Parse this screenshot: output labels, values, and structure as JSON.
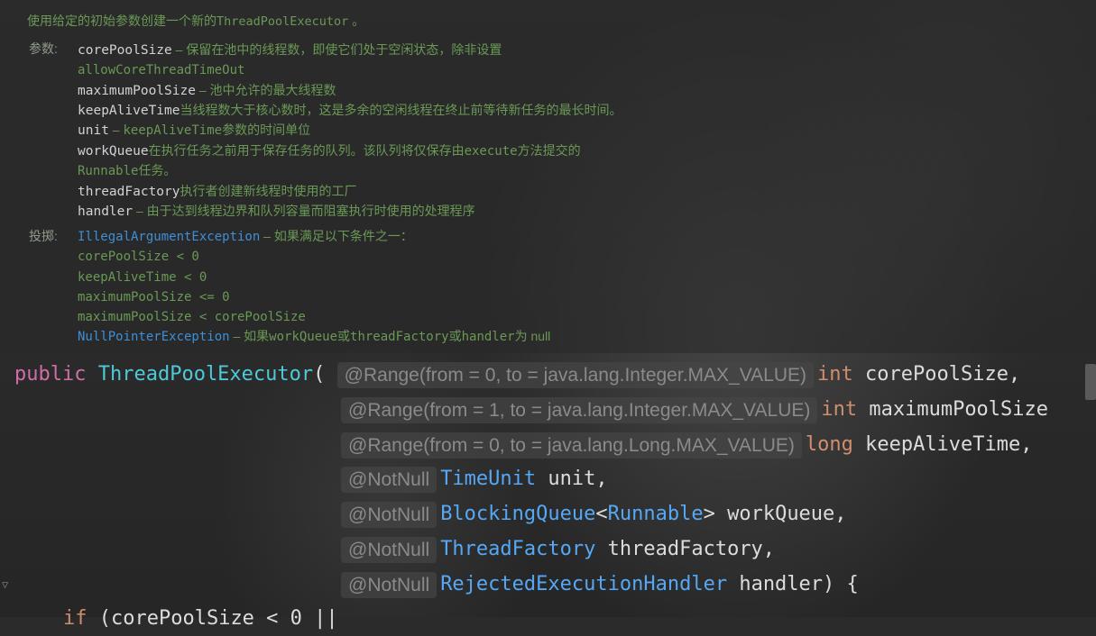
{
  "doc": {
    "intro_text": "使用给定的初始参数创建一个新的",
    "intro_code": "ThreadPoolExecutor",
    "intro_end": " 。",
    "params_label": "参数:",
    "throws_label": "投掷:",
    "params": [
      {
        "name": "corePoolSize",
        "desc": " – 保留在池中的线程数，即使它们处于空闲状态，除非设置"
      },
      {
        "name": "",
        "desc_mono": "allowCoreThreadTimeOut"
      },
      {
        "name": "maximumPoolSize",
        "desc": " – 池中允许的最大线程数"
      },
      {
        "name": "keepAliveTime",
        "desc": "当线程数大于核心数时，这是多余的空闲线程在终止前等待新任务的最长时间。"
      },
      {
        "name": "unit",
        "desc": " – ",
        "desc_mono": "keepAliveTime",
        "desc2": "参数的时间单位"
      },
      {
        "name": "workQueue",
        "desc": "在执行任务之前用于保存任务的队列。该队列将仅保存由",
        "desc_mono": "execute",
        "desc2": "方法提交的"
      },
      {
        "name": "",
        "desc_mono": "Runnable",
        "desc2": "任务。"
      },
      {
        "name": "threadFactory",
        "desc": "执行者创建新线程时使用的工厂"
      },
      {
        "name": "handler",
        "desc": " – 由于达到线程边界和队列容量而阻塞执行时使用的处理程序"
      }
    ],
    "throws": [
      {
        "link": "IllegalArgumentException",
        "desc": " – 如果满足以下条件之一："
      },
      {
        "mono": "corePoolSize < 0"
      },
      {
        "mono": "keepAliveTime < 0"
      },
      {
        "mono": "maximumPoolSize <= 0"
      },
      {
        "mono": "maximumPoolSize < corePoolSize"
      },
      {
        "link": "NullPointerException",
        "desc": " – 如果",
        "desc_mono": "workQueue",
        "desc2": "或",
        "desc_mono2": "threadFactory",
        "desc3": "或",
        "desc_mono3": "handler",
        "desc4": "为 null"
      }
    ]
  },
  "code": {
    "line1": {
      "kw": "public",
      "method": "ThreadPoolExecutor",
      "paren": "(",
      "hint": "@Range(from = 0, to = java.lang.Integer.MAX_VALUE)",
      "type": "int",
      "param": " corePoolSize,"
    },
    "line2": {
      "hint": "@Range(from = 1, to = java.lang.Integer.MAX_VALUE)",
      "type": "int",
      "param": " maximumPoolSize"
    },
    "line3": {
      "hint": "@Range(from = 0, to = java.lang.Long.MAX_VALUE)",
      "type": "long",
      "param": " keepAliveTime,"
    },
    "line4": {
      "hint": "@NotNull",
      "type": "TimeUnit",
      "param": " unit,"
    },
    "line5": {
      "hint": "@NotNull",
      "type": "BlockingQueue",
      "lt": "<",
      "generic": "Runnable",
      "gt": ">",
      "param": " workQueue,"
    },
    "line6": {
      "hint": "@NotNull",
      "type": "ThreadFactory",
      "param": " threadFactory,"
    },
    "line7": {
      "hint": "@NotNull",
      "type": "RejectedExecutionHandler",
      "param": " handler) {"
    },
    "line8": {
      "kw": "if",
      "rest": " (corePoolSize < 0 ||"
    }
  },
  "colors": {
    "background": "#2b2b2b",
    "doc_text": "#6a9955",
    "keyword": "#cf8e6d",
    "type": "#56a8f5",
    "hint_bg": "#464646",
    "link": "#3d8fd6"
  }
}
